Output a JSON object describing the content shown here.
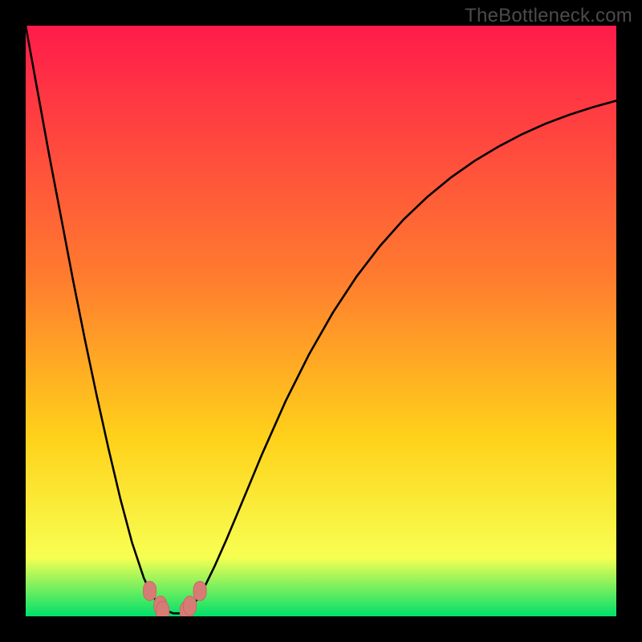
{
  "watermark": "TheBottleneck.com",
  "colors": {
    "top": "#ff1b4b",
    "mid1": "#ff7a2f",
    "mid2": "#ffd21a",
    "mid3": "#f7ff52",
    "bottom": "#00e06a",
    "curve": "#000000",
    "marker_fill": "#d77c75",
    "marker_stroke": "#c46b64"
  },
  "chart_data": {
    "type": "line",
    "title": "",
    "xlabel": "",
    "ylabel": "",
    "xlim": [
      0,
      100
    ],
    "ylim": [
      0,
      100
    ],
    "x": [
      0,
      2,
      4,
      6,
      8,
      10,
      12,
      14,
      16,
      18,
      20,
      21,
      22,
      23,
      24,
      25,
      26,
      27,
      28,
      29,
      30,
      32,
      34,
      36,
      38,
      40,
      44,
      48,
      52,
      56,
      60,
      64,
      68,
      72,
      76,
      80,
      84,
      88,
      92,
      96,
      100
    ],
    "y": [
      100,
      89,
      78,
      67.5,
      57,
      47,
      37.5,
      28.5,
      20,
      12.5,
      6.5,
      4.3,
      2.7,
      1.6,
      0.9,
      0.5,
      0.5,
      0.9,
      1.6,
      2.8,
      4.4,
      8.5,
      13,
      17.8,
      22.6,
      27.4,
      36.4,
      44.4,
      51.4,
      57.5,
      62.7,
      67.2,
      71,
      74.3,
      77.1,
      79.5,
      81.6,
      83.4,
      84.9,
      86.2,
      87.3
    ],
    "markers": [
      {
        "x": 21.0,
        "y": 4.3
      },
      {
        "x": 22.8,
        "y": 1.8
      },
      {
        "x": 23.2,
        "y": 0.9
      },
      {
        "x": 27.2,
        "y": 0.9
      },
      {
        "x": 27.8,
        "y": 1.8
      },
      {
        "x": 29.5,
        "y": 4.3
      }
    ]
  }
}
